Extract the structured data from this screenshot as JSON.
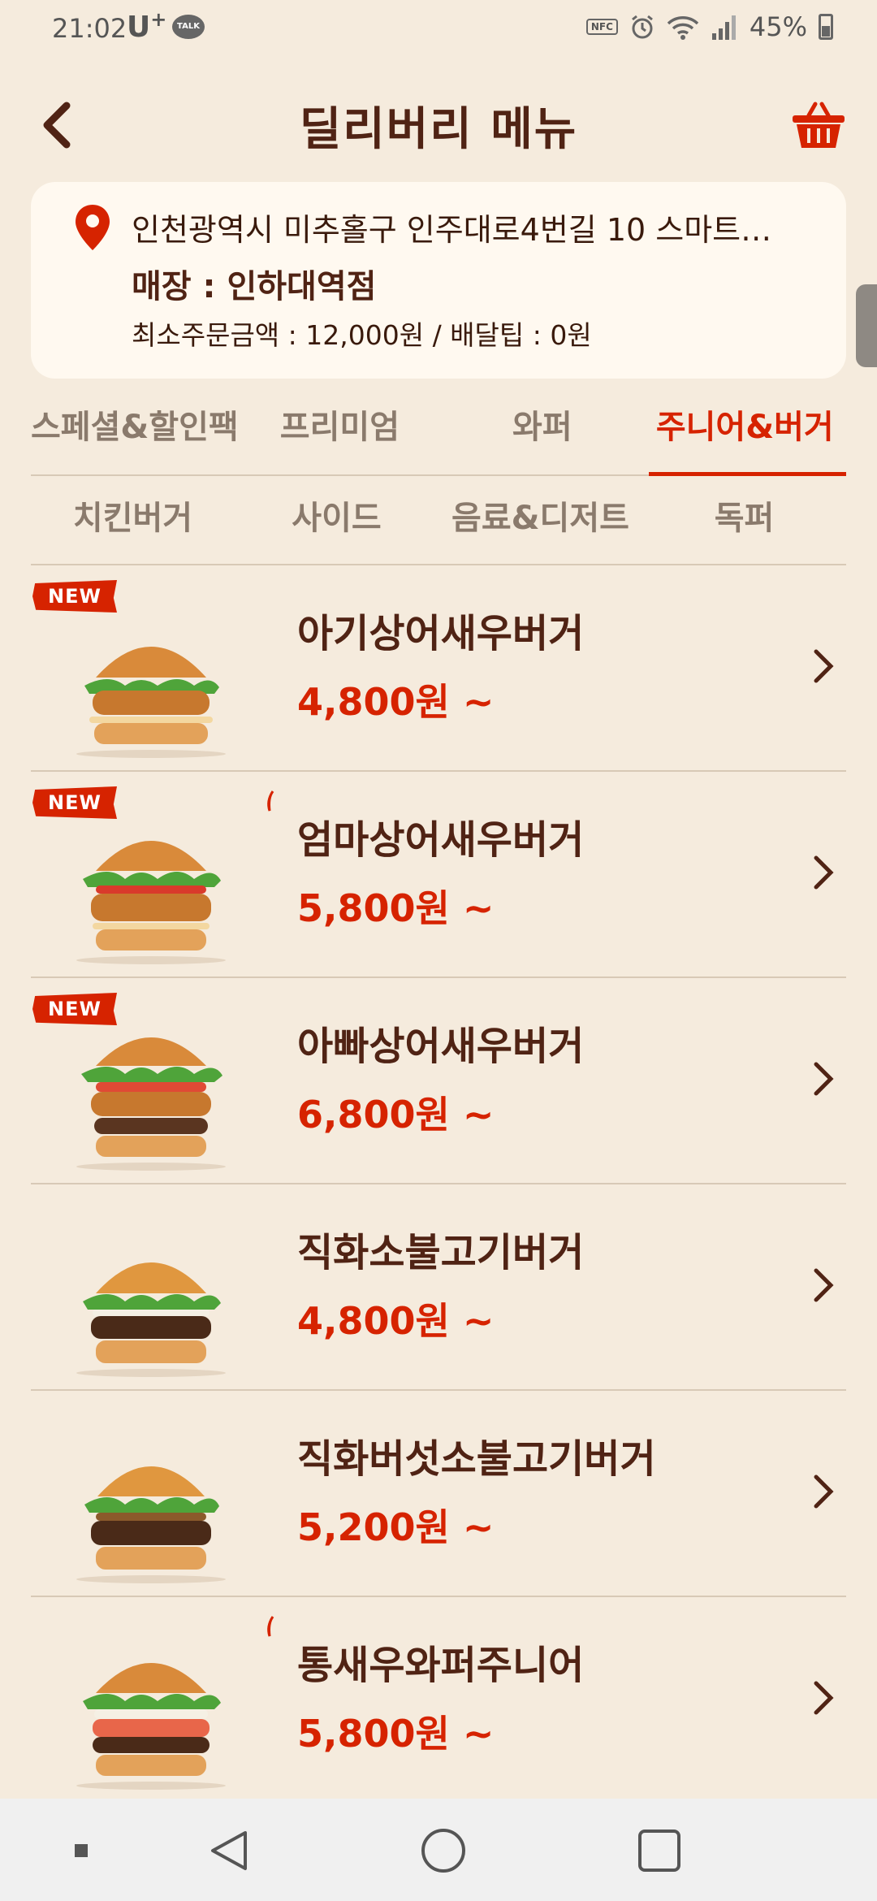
{
  "status_bar": {
    "time": "21:02",
    "carrier": "U",
    "carrier_sup": "+",
    "talk_badge": "TALK",
    "nfc_label": "NFC",
    "battery": "45%"
  },
  "header": {
    "title": "딜리버리 메뉴",
    "back_icon": "back-arrow-icon",
    "cart_icon": "cart-basket-icon"
  },
  "address_card": {
    "address": "인천광역시 미추홀구 인주대로4번길 10 스마트…",
    "store": "매장 : 인하대역점",
    "min_order": "최소주문금액 : 12,000원 / 배달팁 : 0원"
  },
  "tabs": [
    {
      "label": "스페셜&할인팩",
      "active": false
    },
    {
      "label": "프리미엄",
      "active": false
    },
    {
      "label": "와퍼",
      "active": false
    },
    {
      "label": "주니어&버거",
      "active": true
    }
  ],
  "subtabs": [
    {
      "label": "치킨버거"
    },
    {
      "label": "사이드"
    },
    {
      "label": "음료&디저트"
    },
    {
      "label": "독퍼"
    }
  ],
  "menu_items": [
    {
      "name": "아기상어새우버거",
      "price": "4,800원 ~",
      "badge": "NEW",
      "spicy": false
    },
    {
      "name": "엄마상어새우버거",
      "price": "5,800원 ~",
      "badge": "NEW",
      "spicy": true
    },
    {
      "name": "아빠상어새우버거",
      "price": "6,800원 ~",
      "badge": "NEW",
      "spicy": false
    },
    {
      "name": "직화소불고기버거",
      "price": "4,800원 ~",
      "badge": "",
      "spicy": false
    },
    {
      "name": "직화버섯소불고기버거",
      "price": "5,200원 ~",
      "badge": "",
      "spicy": false
    },
    {
      "name": "통새우와퍼주니어",
      "price": "5,800원 ~",
      "badge": "",
      "spicy": true
    }
  ],
  "colors": {
    "background": "#F5EBDD",
    "brand_red": "#D62300",
    "brand_brown": "#502314"
  }
}
